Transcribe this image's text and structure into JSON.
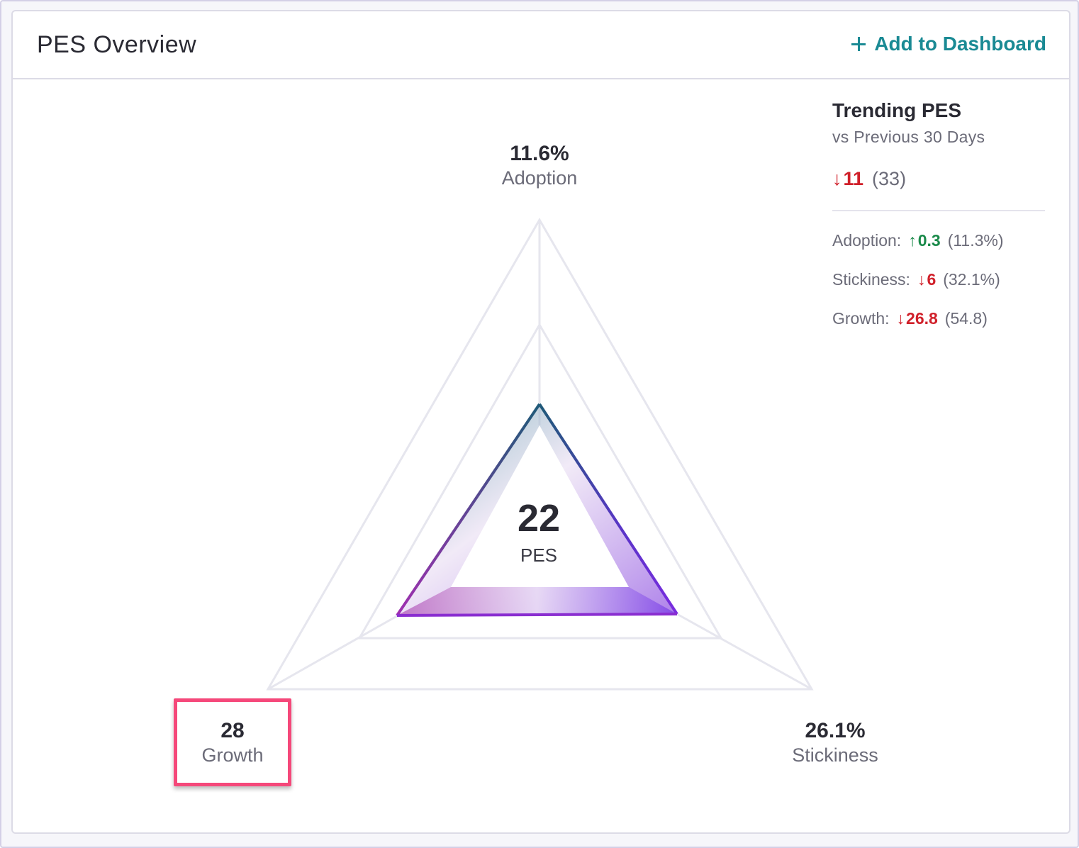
{
  "card": {
    "title": "PES Overview",
    "add_label": "Add to Dashboard"
  },
  "radar": {
    "score": "22",
    "score_label": "PES",
    "adoption": {
      "value": "11.6%",
      "label": "Adoption"
    },
    "stickiness": {
      "value": "26.1%",
      "label": "Stickiness"
    },
    "growth": {
      "value": "28",
      "label": "Growth"
    }
  },
  "trending": {
    "title": "Trending PES",
    "subtitle": "vs Previous 30 Days",
    "change": "11",
    "change_direction": "down",
    "previous": "(33)",
    "metrics": [
      {
        "label": "Adoption:",
        "delta": "0.3",
        "direction": "up",
        "previous": "(11.3%)"
      },
      {
        "label": "Stickiness:",
        "delta": "6",
        "direction": "down",
        "previous": "(32.1%)"
      },
      {
        "label": "Growth:",
        "delta": "26.8",
        "direction": "down",
        "previous": "(54.8)"
      }
    ]
  },
  "colors": {
    "accent": "#1a8a94",
    "down": "#d0202a",
    "up": "#1a8a4a",
    "highlight": "#f5487a"
  }
}
